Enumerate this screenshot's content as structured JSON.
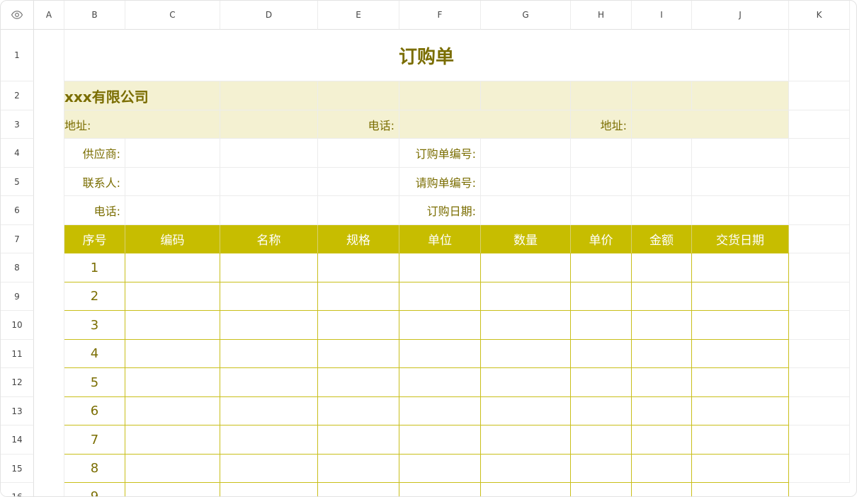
{
  "sheet": {
    "columns": [
      "A",
      "B",
      "C",
      "D",
      "E",
      "F",
      "G",
      "H",
      "I",
      "J",
      "K"
    ],
    "rows": [
      "1",
      "2",
      "3",
      "4",
      "5",
      "6",
      "7",
      "8",
      "9",
      "10",
      "11",
      "12",
      "13",
      "14",
      "15",
      "16"
    ]
  },
  "form": {
    "title": "订购单",
    "company": "xxx有限公司",
    "address_label_left": "地址:",
    "phone_label_mid": "电话:",
    "address_label_right": "地址:",
    "supplier_label": "供应商:",
    "contact_label": "联系人:",
    "phone_label": "电话:",
    "order_no_label": "订购单编号:",
    "request_no_label": "请购单编号:",
    "order_date_label": "订购日期:"
  },
  "table": {
    "headers": [
      "序号",
      "编码",
      "名称",
      "规格",
      "单位",
      "数量",
      "单价",
      "金额",
      "交货日期"
    ],
    "row_numbers": [
      "1",
      "2",
      "3",
      "4",
      "5",
      "6",
      "7",
      "8",
      "9"
    ]
  },
  "colors": {
    "header_fill": "#c7bd00",
    "band_fill": "#f4f1d2",
    "text_olive": "#7a6d00",
    "table_border": "#c9bf1a"
  },
  "icons": {
    "corner": "eye-icon"
  }
}
